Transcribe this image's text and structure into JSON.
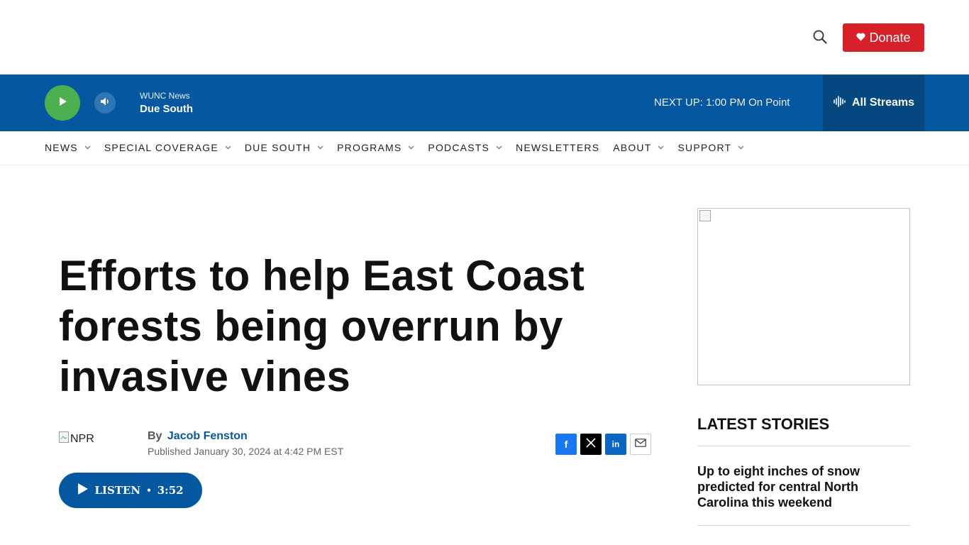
{
  "header": {
    "search_icon": "search-icon",
    "donate_label": "Donate",
    "donate_icon": "heart-icon",
    "brand_color": "#d72027"
  },
  "player": {
    "station_name": "WUNC News",
    "show_name": "Due South",
    "next_up_label": "NEXT UP:",
    "next_up_value": "1:00 PM On Point",
    "all_streams_label": "All Streams",
    "bar_color": "#0558a0",
    "play_color": "#4caf50"
  },
  "nav": {
    "items": [
      {
        "label": "NEWS",
        "has_menu": true
      },
      {
        "label": "SPECIAL COVERAGE",
        "has_menu": true
      },
      {
        "label": "DUE SOUTH",
        "has_menu": true
      },
      {
        "label": "PROGRAMS",
        "has_menu": true
      },
      {
        "label": "PODCASTS",
        "has_menu": true
      },
      {
        "label": "NEWSLETTERS",
        "has_menu": false
      },
      {
        "label": "ABOUT",
        "has_menu": true
      },
      {
        "label": "SUPPORT",
        "has_menu": true
      }
    ]
  },
  "article": {
    "headline": "Efforts to help East Coast forests being overrun by invasive vines",
    "logo_alt": "NPR",
    "by_label": "By",
    "author": "Jacob Fenston",
    "published": "Published January 30, 2024 at 4:42 PM EST",
    "listen_label": "LISTEN",
    "listen_separator": "•",
    "listen_duration": "3:52"
  },
  "share": {
    "facebook": "f",
    "twitter": "X",
    "linkedin": "in",
    "email": "email-icon"
  },
  "sidebar": {
    "latest_title": "LATEST STORIES",
    "stories": [
      {
        "title": "Up to eight inches of snow predicted for central North Carolina this weekend"
      }
    ]
  }
}
